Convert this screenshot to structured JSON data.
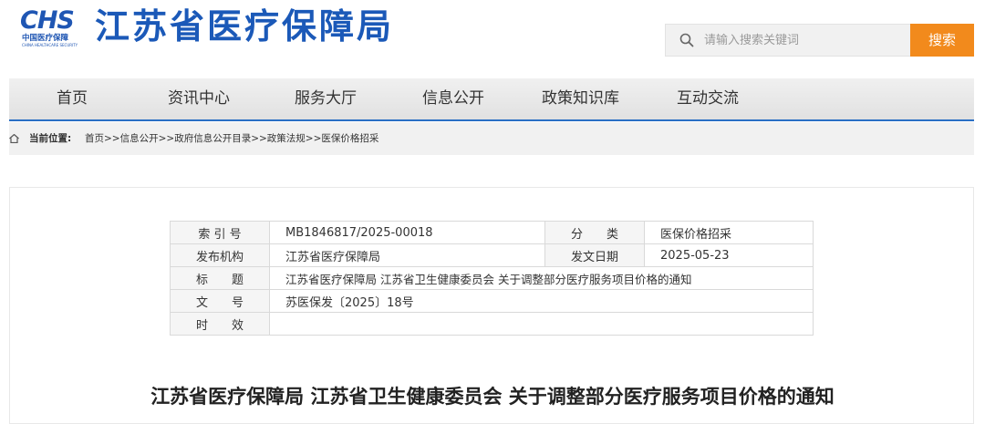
{
  "header": {
    "logo_mark": "CHS",
    "logo_cn": "中国医疗保障",
    "logo_en": "CHINA HEALTHCARE SECURITY",
    "site_title": "江苏省医疗保障局",
    "search_placeholder": "请输入搜索关键词",
    "search_button": "搜索"
  },
  "nav": {
    "items": [
      {
        "label": "首页"
      },
      {
        "label": "资讯中心"
      },
      {
        "label": "服务大厅"
      },
      {
        "label": "信息公开"
      },
      {
        "label": "政策知识库"
      },
      {
        "label": "互动交流"
      }
    ]
  },
  "breadcrumb": {
    "label": "当前位置:",
    "path": "首页>>信息公开>>政府信息公开目录>>政策法规>>医保价格招采"
  },
  "info": {
    "index_label": "索 引 号",
    "index_value": "MB1846817/2025-00018",
    "category_label": "分　　类",
    "category_value": "医保价格招采",
    "publisher_label": "发布机构",
    "publisher_value": "江苏省医疗保障局",
    "date_label": "发文日期",
    "date_value": "2025-05-23",
    "title_label": "标　　题",
    "title_value": "江苏省医疗保障局 江苏省卫生健康委员会 关于调整部分医疗服务项目价格的通知",
    "docno_label": "文　　号",
    "docno_value": "苏医保发〔2025〕18号",
    "validity_label": "时　　效",
    "validity_value": ""
  },
  "article": {
    "title": "江苏省医疗保障局 江苏省卫生健康委员会 关于调整部分医疗服务项目价格的通知"
  },
  "colors": {
    "brand_blue": "#1b59b8",
    "search_orange": "#f28a1c",
    "nav_underline": "#2a6fc4"
  }
}
